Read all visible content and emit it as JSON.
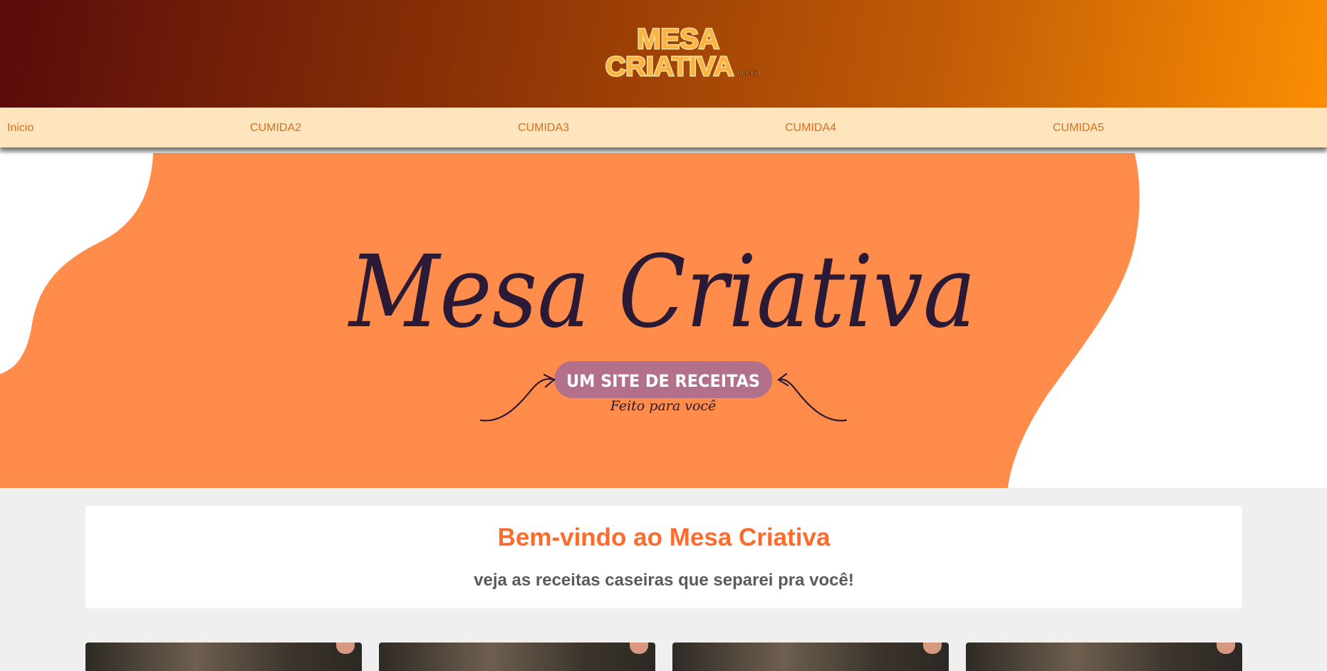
{
  "header": {
    "logo_line1": "MESA",
    "logo_line2": "CRIATIVA",
    "logo_tag": "RECEITAS"
  },
  "nav": {
    "items": [
      {
        "label": "Inicio"
      },
      {
        "label": "CUMIDA2"
      },
      {
        "label": "CUMIDA3"
      },
      {
        "label": "CUMIDA4"
      },
      {
        "label": "CUMIDA5"
      }
    ]
  },
  "banner": {
    "title": "Mesa Criativa",
    "badge": "UM SITE DE RECEITAS",
    "tagline": "Feito para você"
  },
  "welcome": {
    "title": "Bem-vindo ao Mesa Criativa",
    "subtitle": "veja as receitas caseiras que separei pra você!"
  },
  "colors": {
    "header_dark": "#5a0b0b",
    "header_light": "#fb8e03",
    "nav_bg": "#ffe5bd",
    "nav_text": "#d9701f",
    "banner_orange": "#ff8c4a",
    "badge": "#b3708a",
    "welcome_title": "#ff6b2c",
    "page_bg": "#efefef"
  },
  "recipe_cards": [
    {
      "icon": "recipe-photo"
    },
    {
      "icon": "recipe-photo"
    },
    {
      "icon": "recipe-photo"
    },
    {
      "icon": "recipe-photo"
    }
  ]
}
